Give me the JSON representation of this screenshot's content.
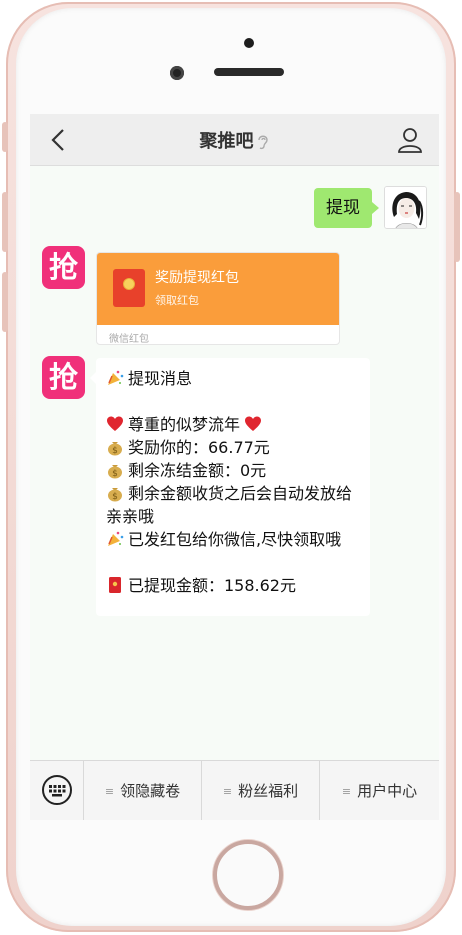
{
  "header": {
    "title": "聚推吧"
  },
  "messages": {
    "me_text": "提现",
    "red_packet": {
      "title": "奖励提现红包",
      "subtitle": "领取红包",
      "footer": "微信红包"
    },
    "notice": {
      "lines": [
        "提现消息",
        "",
        "尊重的似梦流年",
        "奖励你的：66.77元",
        "剩余冻结金额：0元",
        "剩余金额收货之后会自动发放给亲亲哦",
        "已发红包给你微信,尽快领取哦",
        "",
        "已提现金额：158.62元"
      ]
    },
    "bot_avatar_text": "抢"
  },
  "menu": {
    "items": [
      {
        "label": "领隐藏卷"
      },
      {
        "label": "粉丝福利"
      },
      {
        "label": "用户中心"
      }
    ]
  },
  "colors": {
    "bubble_me": "#9fe870",
    "red_packet": "#fa9d3b",
    "bot_avatar": "#f0307a",
    "chat_bg": "#f7fbf7"
  },
  "icons": [
    "back-icon",
    "ear-icon",
    "user-icon",
    "keyboard-icon",
    "party-popper-icon",
    "heart-icon",
    "money-bag-icon",
    "red-envelope-icon"
  ]
}
